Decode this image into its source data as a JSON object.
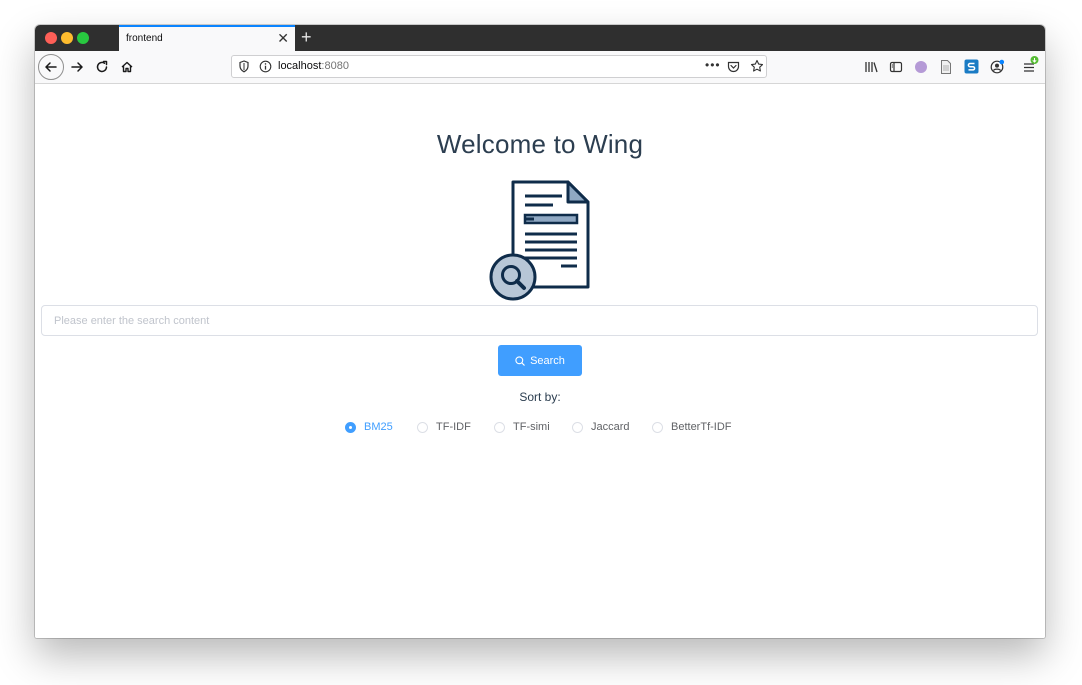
{
  "browser": {
    "tab_title": "frontend",
    "tab_close": "✕",
    "new_tab": "+",
    "url_host": "localhost",
    "url_port": ":8080",
    "page_actions": "•••"
  },
  "page": {
    "title": "Welcome to Wing",
    "search_placeholder": "Please enter the search content",
    "search_button": "Search",
    "sort_label": "Sort by:",
    "sort_options": [
      "BM25",
      "TF-IDF",
      "TF-simi",
      "Jaccard",
      "BetterTf-IDF"
    ],
    "selected_option": "BM25"
  },
  "colors": {
    "primary": "#409eff",
    "heading": "#2c3e50",
    "logo_stroke": "#0f2c4a",
    "logo_fill": "#8fa8c3"
  }
}
